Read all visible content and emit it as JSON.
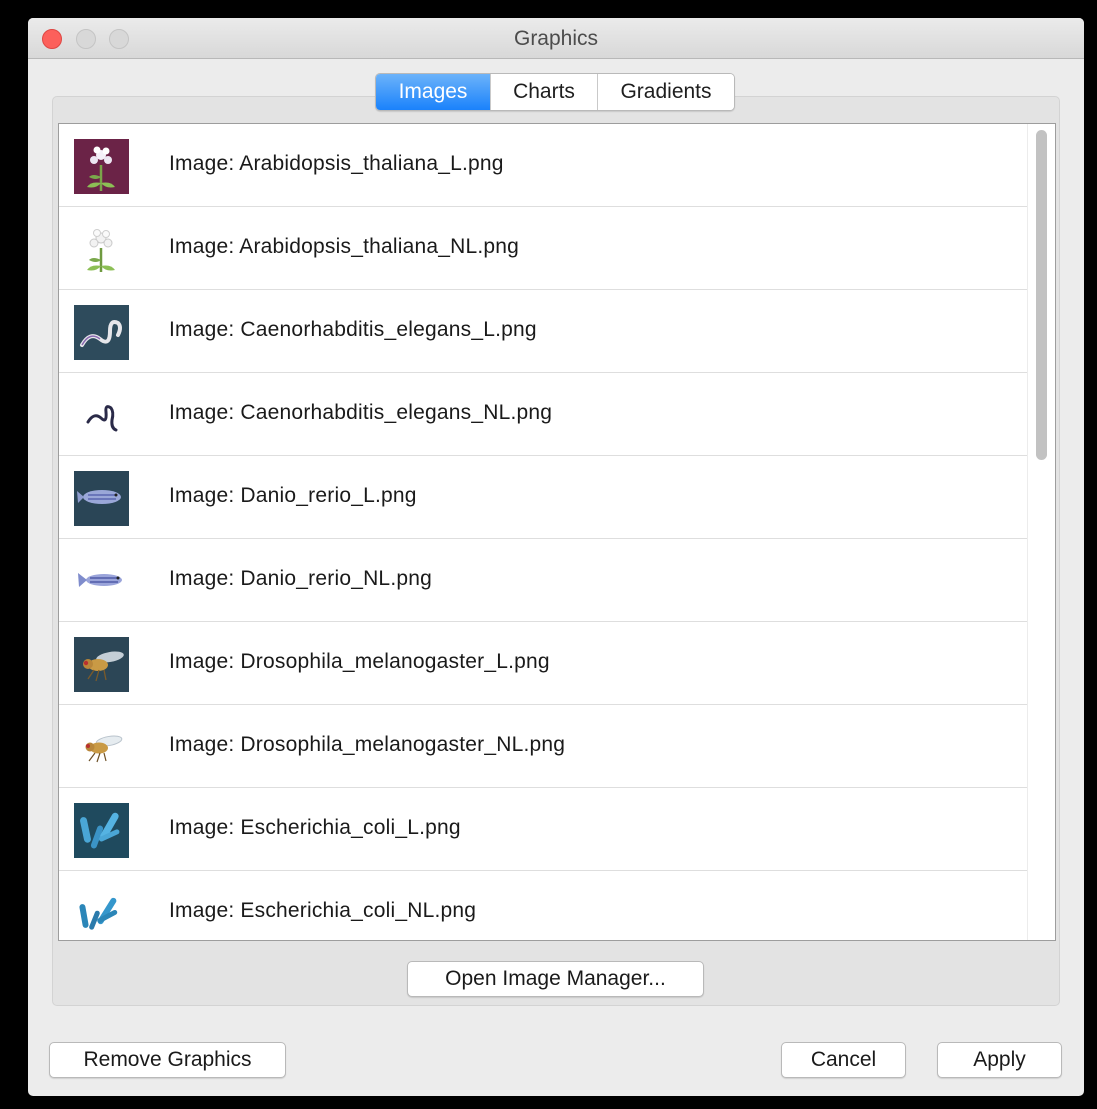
{
  "window": {
    "title": "Graphics"
  },
  "tabs": [
    {
      "label": "Images",
      "active": true
    },
    {
      "label": "Charts",
      "active": false
    },
    {
      "label": "Gradients",
      "active": false
    }
  ],
  "images": [
    {
      "label": "Image: Arabidopsis_thaliana_L.png",
      "icon": "arabidopsis-plant-labeled"
    },
    {
      "label": "Image: Arabidopsis_thaliana_NL.png",
      "icon": "arabidopsis-plant"
    },
    {
      "label": "Image: Caenorhabditis_elegans_L.png",
      "icon": "worm-labeled"
    },
    {
      "label": "Image: Caenorhabditis_elegans_NL.png",
      "icon": "worm"
    },
    {
      "label": "Image: Danio_rerio_L.png",
      "icon": "zebrafish-labeled"
    },
    {
      "label": "Image: Danio_rerio_NL.png",
      "icon": "zebrafish"
    },
    {
      "label": "Image: Drosophila_melanogaster_L.png",
      "icon": "fruit-fly-labeled"
    },
    {
      "label": "Image: Drosophila_melanogaster_NL.png",
      "icon": "fruit-fly"
    },
    {
      "label": "Image: Escherichia_coli_L.png",
      "icon": "bacteria-labeled"
    },
    {
      "label": "Image: Escherichia_coli_NL.png",
      "icon": "bacteria"
    }
  ],
  "buttons": {
    "open_manager": "Open Image Manager...",
    "remove": "Remove Graphics",
    "cancel": "Cancel",
    "apply": "Apply"
  },
  "colors": {
    "accent": "#1a82fb",
    "close": "#fc605b"
  }
}
